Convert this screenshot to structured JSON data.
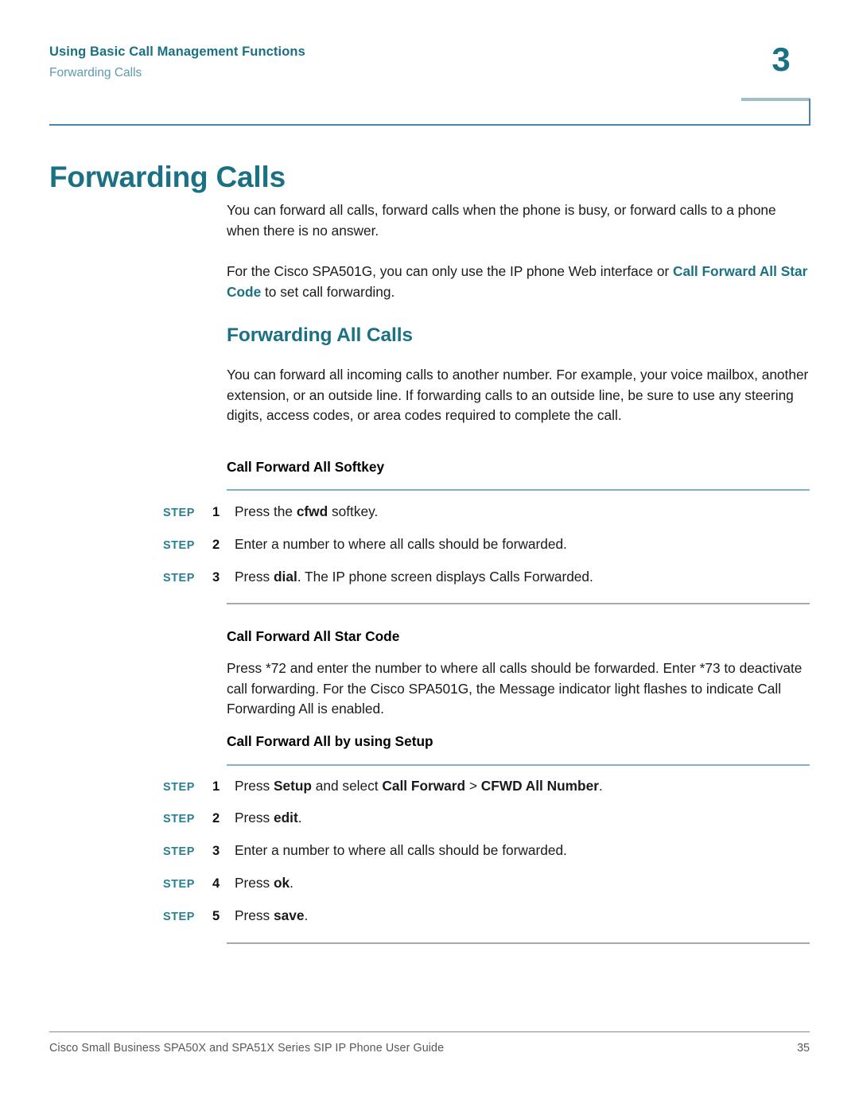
{
  "header": {
    "chapter_title": "Using Basic Call Management Functions",
    "section_title": "Forwarding Calls",
    "chapter_number": "3"
  },
  "page_title": "Forwarding Calls",
  "intro": {
    "paragraph_1": "You can forward all calls, forward calls when the phone is busy, or forward calls to a phone when there is no answer.",
    "paragraph_2_before": "For the Cisco SPA501G, you can only use the IP phone Web interface or ",
    "paragraph_2_xref": "Call Forward All Star Code",
    "paragraph_2_after": " to set call forwarding."
  },
  "section": {
    "heading": "Forwarding All Calls",
    "paragraph": "You can forward all incoming calls to another number. For example, your voice mailbox, another extension, or an outside line. If forwarding calls to an outside line, be sure to use any steering digits, access codes, or area codes required to complete the call."
  },
  "softkey_block": {
    "heading": "Call Forward All Softkey",
    "steps": [
      {
        "label": "STEP",
        "num": "1",
        "text_1": "Press the ",
        "bold_1": "cfwd",
        "text_2": " softkey."
      },
      {
        "label": "STEP",
        "num": "2",
        "text_1": "Enter a number to where all calls should be forwarded.",
        "bold_1": "",
        "text_2": ""
      },
      {
        "label": "STEP",
        "num": "3",
        "text_1": "Press ",
        "bold_1": "dial",
        "text_2": ". The IP phone screen displays Calls Forwarded."
      }
    ]
  },
  "starcode_block": {
    "heading": "Call Forward All Star Code",
    "paragraph": "Press *72 and enter the number to where all calls should be forwarded. Enter *73 to deactivate call forwarding. For the Cisco SPA501G, the Message indicator light flashes to indicate Call Forwarding All is enabled."
  },
  "setup_block": {
    "heading": "Call Forward All by using Setup",
    "steps": [
      {
        "label": "STEP",
        "num": "1",
        "text_1": "Press ",
        "bold_1": "Setup",
        "text_2": " and select ",
        "bold_2": "Call Forward",
        "text_3": " > ",
        "bold_3": "CFWD All Number",
        "text_4": "."
      },
      {
        "label": "STEP",
        "num": "2",
        "text_1": "Press ",
        "bold_1": "edit",
        "text_2": "."
      },
      {
        "label": "STEP",
        "num": "3",
        "text_1": "Enter a number to where all calls should be forwarded.",
        "bold_1": "",
        "text_2": ""
      },
      {
        "label": "STEP",
        "num": "4",
        "text_1": "Press ",
        "bold_1": "ok",
        "text_2": "."
      },
      {
        "label": "STEP",
        "num": "5",
        "text_1": "Press ",
        "bold_1": "save",
        "text_2": "."
      }
    ]
  },
  "footer": {
    "document_title": "Cisco Small Business SPA50X and SPA51X Series SIP IP Phone User Guide",
    "page_number": "35"
  },
  "colors": {
    "accent_teal": "#1b7184",
    "step_teal": "#2b7f95",
    "rule_blue": "#7fb2cd",
    "rule_gray": "#a8a8a8",
    "header_rule": "#4b84ab",
    "subtitle_teal": "#5f9aab",
    "footer_gray": "#58585a"
  }
}
